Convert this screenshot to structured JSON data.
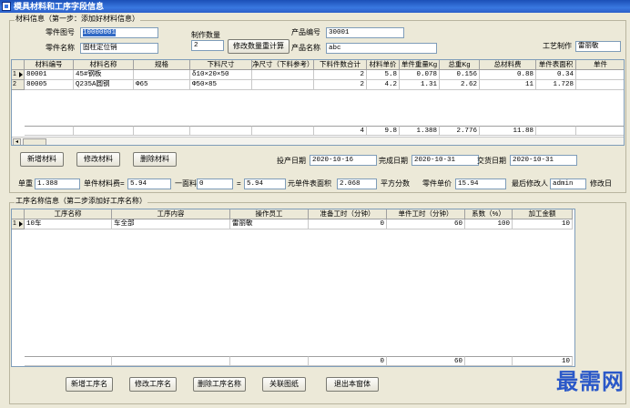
{
  "window": {
    "title": "模具材料和工序字段信息"
  },
  "material_group": {
    "label": "材料信息（第一步：添加好材料信息）"
  },
  "form": {
    "part_no_label": "零件图号",
    "part_no_value": "10000001",
    "make_qty_label": "制作数量",
    "make_qty_value": "2",
    "modify_qty_button": "修改数量重计算",
    "product_no_label": "产品编号",
    "product_no_value": "30001",
    "part_name_label": "零件名称",
    "part_name_value": "固柱定位销",
    "product_name_label": "产品名称",
    "product_name_value": "abc",
    "craft_label": "工艺制作",
    "craft_value": "雷丽敏"
  },
  "material_table": {
    "headers": [
      "材料编号",
      "材料名称",
      "规格",
      "下料尺寸",
      "净尺寸（下料参考）",
      "下料件数合计",
      "材料单价",
      "单件重量Kg",
      "总重Kg",
      "总材料费",
      "单件表面积",
      "单件"
    ],
    "rows": [
      {
        "rownum": "1",
        "pointer": true,
        "cells": [
          "80001",
          "45#钢板",
          "",
          "δ10×20×50",
          "",
          "2",
          "5.8",
          "0.078",
          "0.156",
          "0.88",
          "0.34",
          ""
        ]
      },
      {
        "rownum": "2",
        "pointer": false,
        "cells": [
          "80005",
          "Q235A圆钢",
          "Φ65",
          "Φ50×85",
          "",
          "2",
          "4.2",
          "1.31",
          "2.62",
          "11",
          "1.728",
          ""
        ]
      }
    ],
    "totals": [
      "",
      "",
      "",
      "",
      "",
      "4",
      "9.8",
      "1.388",
      "2.776",
      "11.88",
      "",
      ""
    ]
  },
  "material_buttons": {
    "add": "新增材料",
    "edit": "修改材料",
    "delete": "删除材料"
  },
  "dates": {
    "invest_label": "投产日期",
    "invest_value": "2020-10-16",
    "finish_label": "完成日期",
    "finish_value": "2020-10-31",
    "deliver_label": "交货日期",
    "deliver_value": "2020-10-31"
  },
  "calc": {
    "unit_weight_label": "单重",
    "unit_weight_value": "1.388",
    "unit_material_label": "单件材料费=",
    "unit_material_value": "5.94",
    "sep1": "一面料",
    "face_value": "0",
    "eq": "=",
    "eq_value": "5.94",
    "area_label": "元单件表面积",
    "area_value": "2.068",
    "area_unit": "平方分数",
    "part_price_label": "零件单价",
    "part_price_value": "15.94",
    "modifier_label": "最后修改人",
    "modifier_value": "admin",
    "modify_date_label": "修改日"
  },
  "process_group": {
    "label": "工序名称信息（第二步添加好工序名称）"
  },
  "process_table": {
    "headers": [
      "工序名称",
      "工序内容",
      "操作员工",
      "准备工时（分钟）",
      "单件工时（分钟）",
      "系数（%）",
      "加工金额"
    ],
    "rows": [
      {
        "rownum": "1",
        "pointer": true,
        "cells": [
          "10车",
          "车全部",
          "雷丽敏",
          "0",
          "60",
          "100",
          "10"
        ]
      }
    ],
    "totals": [
      "",
      "",
      "",
      "0",
      "60",
      "",
      "10"
    ]
  },
  "process_buttons": {
    "add": "新增工序名",
    "edit": "修改工序名",
    "delete": "删除工序名称",
    "link": "关联图纸",
    "exit": "退出本窗体"
  },
  "watermark": "最需网"
}
